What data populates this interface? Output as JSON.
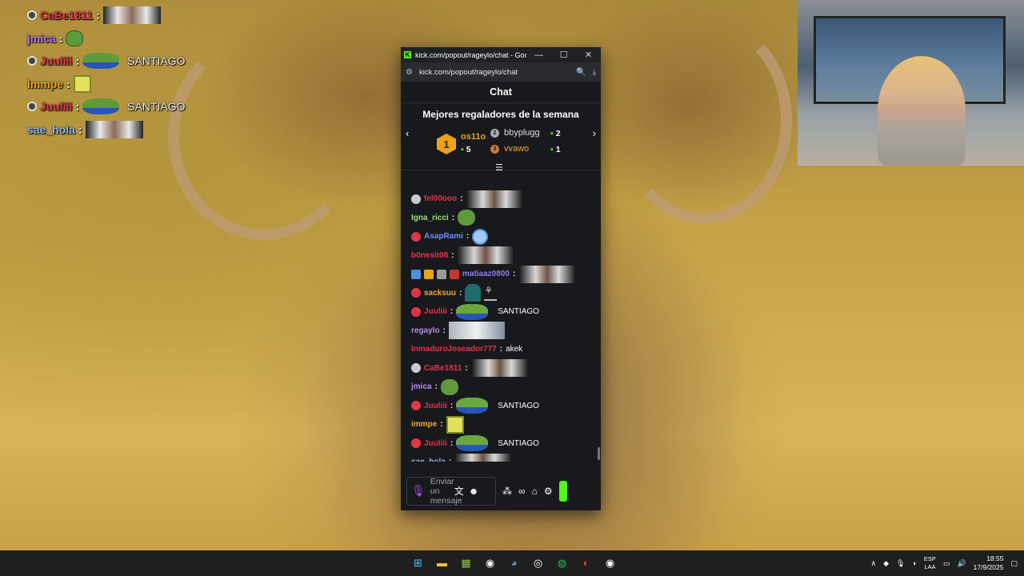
{
  "overlay_chat": [
    {
      "user": "CaBe1811",
      "color": "#e3344a",
      "badge": true,
      "emote": "face"
    },
    {
      "user": "jmica",
      "color": "#b27ae6",
      "badge": false,
      "emote": "pepe"
    },
    {
      "user": "Juuliii",
      "color": "#e3344a",
      "badge": true,
      "emote": "pepe-wide",
      "text": "SANTIAGO"
    },
    {
      "user": "immpe",
      "color": "#e9a820",
      "badge": false,
      "emote": "sponge"
    },
    {
      "user": "Juuliii",
      "color": "#e3344a",
      "badge": true,
      "emote": "pepe-wide",
      "text": "SANTIAGO"
    },
    {
      "user": "sae_hola",
      "color": "#8fb9ea",
      "badge": false,
      "emote": "face"
    }
  ],
  "window": {
    "title": "kick.com/popout/rageylo/chat - Goog...",
    "url": "kick.com/popout/rageylo/chat",
    "minimize": "—",
    "maximize": "☐",
    "close": "✕"
  },
  "chat": {
    "header": "Chat",
    "gifters_title": "Mejores regaladores de la semana",
    "gifters": [
      {
        "rank": "1",
        "name": "os11o",
        "count": "5"
      },
      {
        "rank": "2",
        "name": "bbyplugg",
        "count": "2"
      },
      {
        "rank": "3",
        "name": "vvawo",
        "count": "1"
      }
    ],
    "messages": [
      {
        "user": "fel00ooo",
        "color": "#e3344a",
        "badge": "#cccccc",
        "emote": "face"
      },
      {
        "user": "Igna_ricci",
        "color": "#9be07a",
        "badge": "",
        "emote": "pepe"
      },
      {
        "user": "AsapRami",
        "color": "#6b8ef7",
        "badge": "#e3344a",
        "emote": "blue"
      },
      {
        "user": "b0nesit08",
        "color": "#e3344a",
        "badge": "",
        "emote": "face"
      },
      {
        "user": "matiaaz0800",
        "color": "#8c7cf0",
        "badge": "#4a90e2",
        "emote": "face",
        "extra_badges": true
      },
      {
        "user": "sacksuu",
        "color": "#f2a63a",
        "badge": "#e3344a",
        "emote": "monster"
      },
      {
        "user": "Juuliii",
        "color": "#e3344a",
        "badge": "#e3344a",
        "emote": "pepe-wide",
        "text": "SANTIAGO"
      },
      {
        "user": "regaylo",
        "color": "#b68cf0",
        "badge": "",
        "emote": "regaylo"
      },
      {
        "user": "InmaduroJoseador777",
        "color": "#e3344a",
        "badge": "",
        "emote": "",
        "text": "akek"
      },
      {
        "user": "CaBe1811",
        "color": "#e3344a",
        "badge": "#cccccc",
        "emote": "face"
      },
      {
        "user": "jmica",
        "color": "#b68cf0",
        "badge": "",
        "emote": "pepe"
      },
      {
        "user": "Juuliii",
        "color": "#e3344a",
        "badge": "#e3344a",
        "emote": "pepe-wide",
        "text": "SANTIAGO"
      },
      {
        "user": "immpe",
        "color": "#f2a63a",
        "badge": "",
        "emote": "sponge"
      },
      {
        "user": "Juuliii",
        "color": "#e3344a",
        "badge": "#e3344a",
        "emote": "pepe-wide",
        "text": "SANTIAGO"
      },
      {
        "user": "sae_hola",
        "color": "#8fb9ea",
        "badge": "",
        "emote": "face"
      }
    ],
    "input_placeholder": "Enviar un mensaje"
  },
  "taskbar": {
    "lang_top": "ESP",
    "lang_bottom": "LAA",
    "time": "18:55",
    "date": "17/9/2025"
  }
}
